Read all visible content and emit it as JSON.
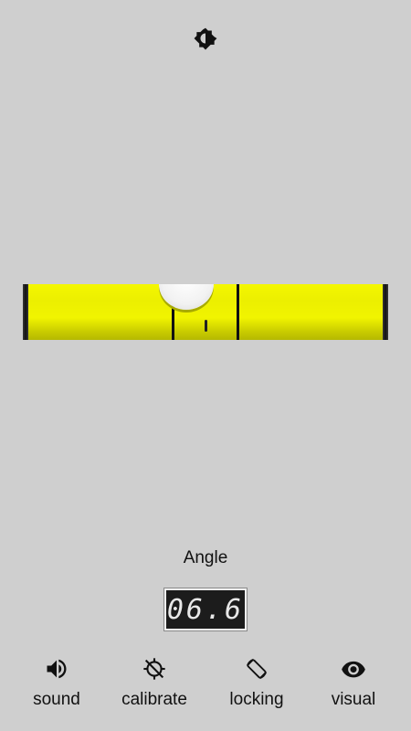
{
  "header": {
    "brightness_icon": "brightness-contrast-icon"
  },
  "level": {
    "bubble_offset_fraction": -0.13,
    "colors": {
      "tube": "#f4f700",
      "tube_shadow": "#b5b800",
      "bubble": "#f2f2f2",
      "caps": "#111111"
    }
  },
  "angle": {
    "label": "Angle",
    "value": "06.6"
  },
  "toolbar": {
    "items": [
      {
        "label": "sound",
        "icon": "speaker-icon"
      },
      {
        "label": "calibrate",
        "icon": "calibrate-icon"
      },
      {
        "label": "locking",
        "icon": "screen-rotation-icon"
      },
      {
        "label": "visual",
        "icon": "eye-icon"
      }
    ]
  },
  "theme": {
    "background": "#cfcfcf",
    "text": "#111111",
    "display_bg": "#1c1c1c",
    "display_text": "#e8e8e8"
  }
}
